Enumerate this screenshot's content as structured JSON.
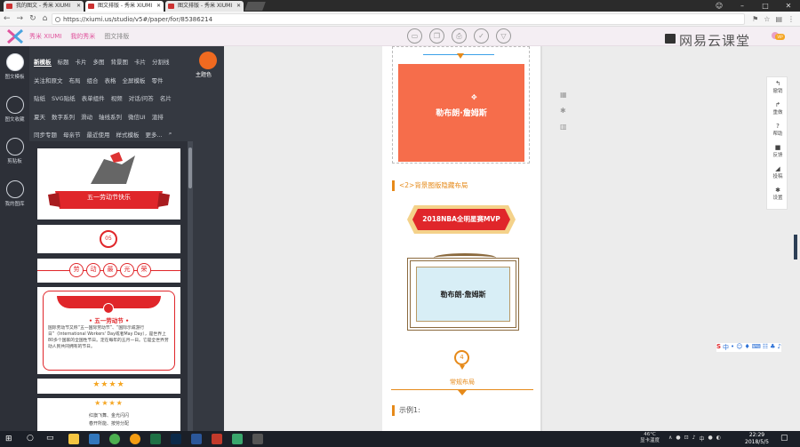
{
  "browser": {
    "tabs": [
      {
        "label": "我的图文 - 秀米 XIUMI"
      },
      {
        "label": "图文排版 - 秀米 XIUMI"
      },
      {
        "label": "图文排版 - 秀米 XIUMI"
      }
    ],
    "url": "https://xiumi.us/studio/v5#/paper/for/85386214"
  },
  "header": {
    "brand": "秀米 XIUMI",
    "nav": [
      "我的秀米",
      "图文排版"
    ],
    "watermark": "网易云课堂",
    "vip_badge": "VIP"
  },
  "left_nav": [
    {
      "label": "图文模板",
      "icon": "list-icon"
    },
    {
      "label": "图文收藏",
      "icon": "collect-icon"
    },
    {
      "label": "剪贴板",
      "icon": "clipboard-icon"
    },
    {
      "label": "我的图库",
      "icon": "image-icon"
    }
  ],
  "panel": {
    "row1": [
      "新模板",
      "标题",
      "卡片",
      "多图",
      "背景图",
      "卡片",
      "分割线"
    ],
    "row2": [
      "关注和原文",
      "布局",
      "组合",
      "表格",
      "全屏模板",
      "零件"
    ],
    "row3": [
      "贴纸",
      "SVG贴纸",
      "表单组件",
      "视频",
      "对话/问答",
      "名片"
    ],
    "row4": [
      "夏天",
      "数字系列",
      "滑动",
      "轴线系列",
      "微信UI",
      "渲排"
    ],
    "row5": [
      "同步专题",
      "母亲节",
      "最近使用",
      "样式模板",
      "更多..."
    ],
    "theme_label": "主题色",
    "theme_color": "#f06a20",
    "cards": {
      "c1_title": "五一劳动节快乐",
      "c2_num": "05",
      "c3_chars": [
        "劳",
        "动",
        "最",
        "光",
        "荣"
      ],
      "c4_title": "• 五一劳动节 •",
      "c4_text": "国际劳动节又称“五一国际劳动节”、“国际示威游行日”（International Workers' Day或者May Day），是世界上80多个国家的全国性节日。定在每年的五月一日。它是全世界劳动人民共同拥有的节日。",
      "c5_stars": "★★★★",
      "c6_stars": "★★★★",
      "c6_text1": "红旗飞舞、金光闪闪",
      "c6_text2": "春开所能、按劳分配"
    }
  },
  "article": {
    "name1": "勒布朗·詹姆斯",
    "section_heading": "<2>背景图版隐藏布局",
    "banner": "2018NBA全明星赛MVP",
    "name2": "勒布朗·詹姆斯",
    "badge_num": "4",
    "common_layout": "常规布局",
    "example": "示例1:"
  },
  "tools": [
    {
      "label": "撤销",
      "glyph": "↰"
    },
    {
      "label": "重做",
      "glyph": "↱"
    },
    {
      "label": "帮助",
      "glyph": "?"
    },
    {
      "label": "反馈",
      "glyph": "■"
    },
    {
      "label": "投稿",
      "glyph": "◢"
    },
    {
      "label": "设置",
      "glyph": "✱"
    }
  ],
  "ime": [
    "S",
    "中",
    "•",
    "☺",
    "♦",
    "⌨",
    "☷",
    "♣",
    "♪"
  ],
  "taskbar": {
    "weather_temp": "46°C",
    "weather_label": "显卡温度",
    "ime_lang": "中",
    "time": "22:29",
    "date": "2018/5/5"
  }
}
